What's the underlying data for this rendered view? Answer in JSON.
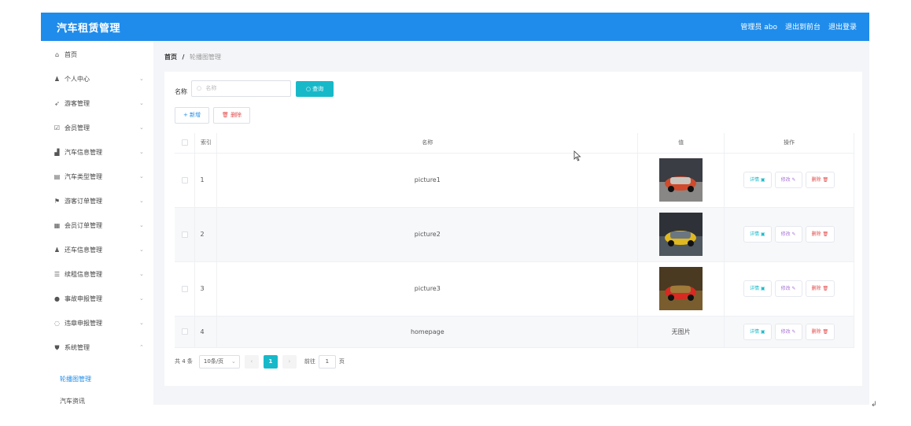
{
  "header": {
    "title": "汽车租赁管理",
    "admin_label": "管理员 abo",
    "back_to_front": "退出到前台",
    "logout": "退出登录"
  },
  "sidebar": {
    "items": [
      {
        "label": "首页",
        "icon": "home-icon",
        "icon_glyph": "⌂",
        "expandable": false
      },
      {
        "label": "个人中心",
        "icon": "user-icon",
        "icon_glyph": "♟",
        "expandable": true
      },
      {
        "label": "游客管理",
        "icon": "send-icon",
        "icon_glyph": "➶",
        "expandable": true
      },
      {
        "label": "会员管理",
        "icon": "check-square-icon",
        "icon_glyph": "☑",
        "expandable": true
      },
      {
        "label": "汽车信息管理",
        "icon": "chart-icon",
        "icon_glyph": "▟",
        "expandable": true
      },
      {
        "label": "汽车类型管理",
        "icon": "list-icon",
        "icon_glyph": "▤",
        "expandable": true
      },
      {
        "label": "游客订单管理",
        "icon": "flag-icon",
        "icon_glyph": "⚑",
        "expandable": true
      },
      {
        "label": "会员订单管理",
        "icon": "clipboard-icon",
        "icon_glyph": "▦",
        "expandable": true
      },
      {
        "label": "还车信息管理",
        "icon": "person-icon",
        "icon_glyph": "♟",
        "expandable": true
      },
      {
        "label": "续租信息管理",
        "icon": "menu-icon",
        "icon_glyph": "☰",
        "expandable": true
      },
      {
        "label": "事故申报管理",
        "icon": "pin-icon",
        "icon_glyph": "●",
        "expandable": true
      },
      {
        "label": "违章申报管理",
        "icon": "circle-icon",
        "icon_glyph": "◌",
        "expandable": true
      },
      {
        "label": "系统管理",
        "icon": "shield-icon",
        "icon_glyph": "⛊",
        "expandable": true,
        "expanded": true
      }
    ],
    "sub_items": [
      {
        "label": "轮播图管理",
        "active": true
      },
      {
        "label": "汽车资讯",
        "active": false
      }
    ],
    "chevron_down": "⌄",
    "chevron_up": "⌃"
  },
  "breadcrumb": {
    "home": "首页",
    "separator": "/",
    "current": "轮播图管理"
  },
  "search": {
    "label": "名称",
    "placeholder": "名称",
    "search_icon_glyph": "○",
    "query_button": "查询"
  },
  "toolbar": {
    "add_label": "+ 新增",
    "delete_label": "删除",
    "delete_icon_glyph": "🗑"
  },
  "table": {
    "columns": [
      "索引",
      "名称",
      "值",
      "操作"
    ],
    "rows": [
      {
        "index": "1",
        "name": "picture1",
        "value": "",
        "has_image": true,
        "image_colors": [
          "#3a3d44",
          "#c9c4bc",
          "#d14a2c"
        ]
      },
      {
        "index": "2",
        "name": "picture2",
        "value": "",
        "has_image": true,
        "image_colors": [
          "#2e3238",
          "#6c7680",
          "#e0b820"
        ]
      },
      {
        "index": "3",
        "name": "picture3",
        "value": "",
        "has_image": true,
        "image_colors": [
          "#4a3a22",
          "#a07a38",
          "#d62a22"
        ]
      },
      {
        "index": "4",
        "name": "homepage",
        "value": "无图片",
        "has_image": false,
        "image_colors": []
      }
    ],
    "actions": {
      "detail": "详情 ▣",
      "edit": "修改 ✎",
      "delete": "删除 🗑"
    }
  },
  "pagination": {
    "total": "共 4 条",
    "page_size": "10条/页",
    "prev": "‹",
    "current": "1",
    "next": "›",
    "goto_prefix": "前往",
    "goto_value": "1",
    "goto_suffix": "页"
  },
  "colors": {
    "header_bg": "#1f8ceb",
    "accent_teal": "#17b9c9",
    "danger": "#e24b4b",
    "edit": "#a874d8"
  },
  "misc": {
    "corner_mark": "↲"
  }
}
